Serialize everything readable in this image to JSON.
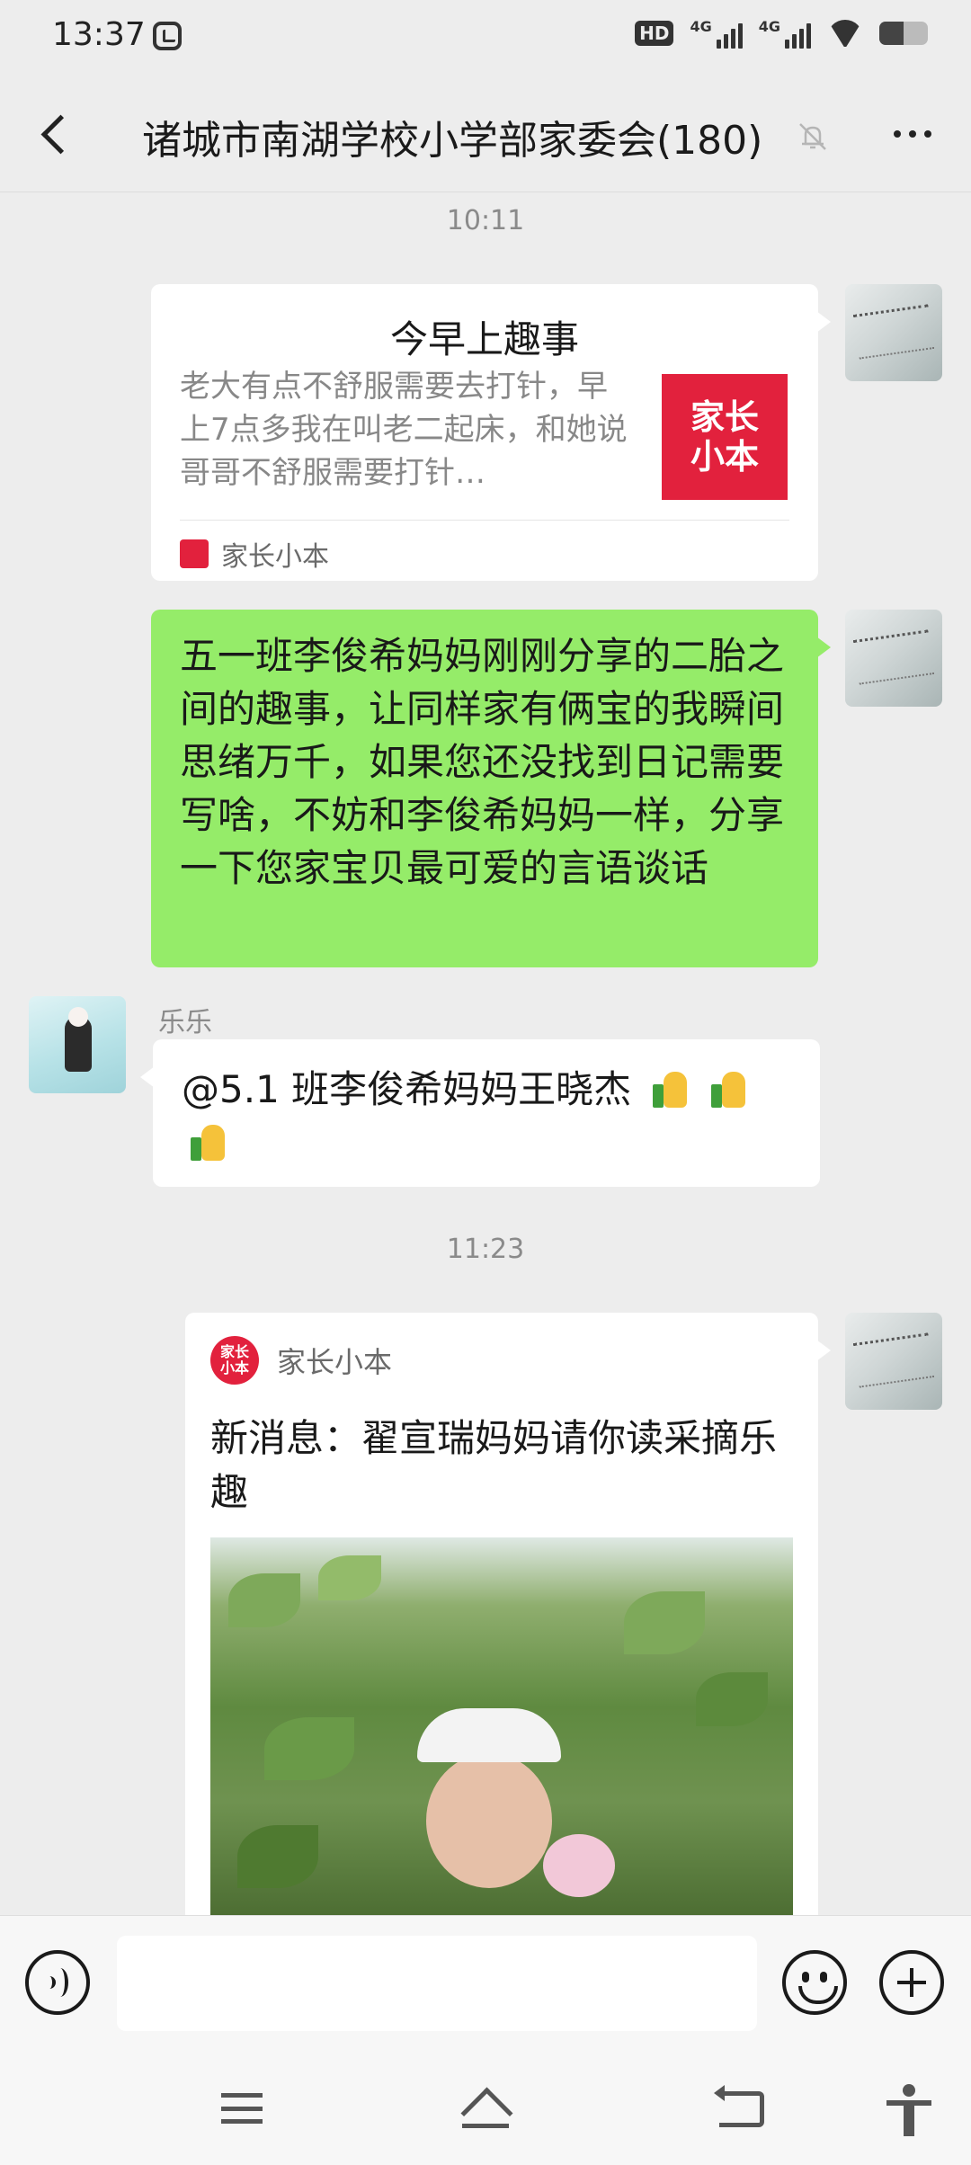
{
  "status_bar": {
    "time": "13:37",
    "hd_label": "HD",
    "net1_label": "4G",
    "net2_label": "4G",
    "battery_level": 0.5
  },
  "header": {
    "title": "诸城市南湖学校小学部家委会(180)"
  },
  "messages": {
    "time1": "10:11",
    "link_card": {
      "title": "今早上趣事",
      "description": "老大有点不舒服需要去打针，早上7点多我在叫老二起床，和她说哥哥不舒服需要打针…",
      "thumb_line1": "家长",
      "thumb_line2": "小本",
      "source": "家长小本"
    },
    "text_msg": "五一班李俊希妈妈刚刚分享的二胎之间的趣事，让同样家有俩宝的我瞬间思绪万千，如果您还没找到日记需要写啥，不妨和李俊希妈妈一样，分享一下您家宝贝最可爱的言语谈话",
    "reply": {
      "sender": "乐乐",
      "text": "@5.1 班李俊希妈妈王晓杰"
    },
    "time2": "11:23",
    "mini_program": {
      "name": "家长小本",
      "logo_line1": "家长",
      "logo_line2": "小本",
      "title": "新消息：翟宣瑞妈妈请你读采摘乐趣"
    }
  },
  "input_bar": {
    "placeholder": ""
  }
}
